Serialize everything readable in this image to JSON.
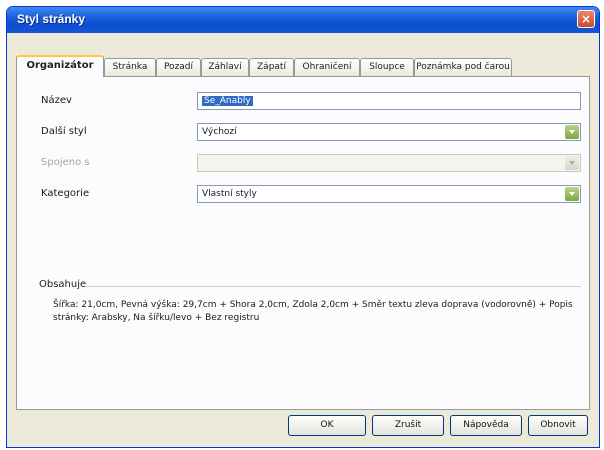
{
  "window": {
    "title": "Styl stránky",
    "close": "×"
  },
  "tabs": [
    {
      "label": "Organizátor",
      "active": true
    },
    {
      "label": "Stránka"
    },
    {
      "label": "Pozadí"
    },
    {
      "label": "Záhlaví"
    },
    {
      "label": "Zápatí"
    },
    {
      "label": "Ohraničení"
    },
    {
      "label": "Sloupce"
    },
    {
      "label": "Poznámka pod čarou"
    }
  ],
  "form": {
    "name_label": "Název",
    "name_value": "Se_Anably",
    "next_style_label": "Další styl",
    "next_style_value": "Výchozí",
    "linked_label": "Spojeno s",
    "linked_value": "",
    "category_label": "Kategorie",
    "category_value": "Vlastní styly"
  },
  "contains": {
    "label": "Obsahuje",
    "text": "Šířka: 21,0cm, Pevná výška: 29,7cm + Shora 2,0cm, Zdola 2,0cm + Směr textu zleva doprava (vodorovně) + Popis stránky: Arabsky, Na šířku/levo + Bez registru"
  },
  "buttons": {
    "ok": "OK",
    "cancel": "Zrušit",
    "help": "Nápověda",
    "reset": "Obnovit"
  },
  "colors": {
    "titlebar": "#0b4fd0",
    "dialog_bg": "#ece9d8",
    "selection": "#316ac5"
  }
}
